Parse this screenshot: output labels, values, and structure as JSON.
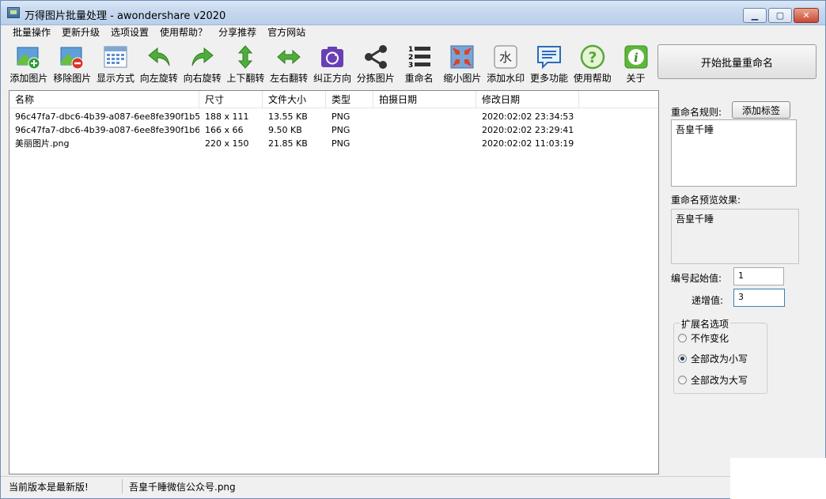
{
  "window": {
    "title": "万得图片批量处理 - awondershare v2020"
  },
  "menu": [
    "批量操作",
    "更新升级",
    "选项设置",
    "使用帮助？",
    "分享推荐",
    "官方网站"
  ],
  "toolbar": [
    {
      "label": "添加图片",
      "icon": "add-image-icon"
    },
    {
      "label": "移除图片",
      "icon": "remove-image-icon"
    },
    {
      "label": "显示方式",
      "icon": "display-mode-icon"
    },
    {
      "label": "向左旋转",
      "icon": "rotate-left-icon"
    },
    {
      "label": "向右旋转",
      "icon": "rotate-right-icon"
    },
    {
      "label": "上下翻转",
      "icon": "flip-vertical-icon"
    },
    {
      "label": "左右翻转",
      "icon": "flip-horizontal-icon"
    },
    {
      "label": "纠正方向",
      "icon": "correct-orientation-icon"
    },
    {
      "label": "分拣图片",
      "icon": "sort-images-icon"
    },
    {
      "label": "重命名",
      "icon": "rename-icon"
    },
    {
      "label": "缩小图片",
      "icon": "shrink-image-icon"
    },
    {
      "label": "添加水印",
      "icon": "watermark-icon"
    },
    {
      "label": "更多功能",
      "icon": "more-features-icon"
    },
    {
      "label": "使用帮助",
      "icon": "help-icon"
    },
    {
      "label": "关于",
      "icon": "info-icon"
    }
  ],
  "start_button": "开始批量重命名",
  "filelist": {
    "columns": [
      "名称",
      "尺寸",
      "文件大小",
      "类型",
      "拍摄日期",
      "修改日期"
    ],
    "rows": [
      [
        "96c47fa7-dbc6-4b39-a087-6ee8fe390f1b5.png",
        "188 x 111",
        "13.55 KB",
        "PNG",
        "",
        "2020:02:02 23:34:53"
      ],
      [
        "96c47fa7-dbc6-4b39-a087-6ee8fe390f1b6.png",
        "166 x 66",
        "9.50 KB",
        "PNG",
        "",
        "2020:02:02 23:29:41"
      ],
      [
        "美丽图片.png",
        "220 x 150",
        "21.85 KB",
        "PNG",
        "",
        "2020:02:02 11:03:19"
      ]
    ]
  },
  "right_panel": {
    "rule_label": "重命名规则:",
    "add_tag_button": "添加标签",
    "rule_value": "吾皇千睡",
    "preview_label": "重命名预览效果:",
    "preview_value": "吾皇千睡",
    "start_num_label": "编号起始值:",
    "start_num_value": "1",
    "increment_label": "递增值:",
    "increment_value": "3",
    "ext_group_label": "扩展名选项",
    "ext_options": [
      {
        "label": "不作变化",
        "checked": false
      },
      {
        "label": "全部改为小写",
        "checked": true
      },
      {
        "label": "全部改为大写",
        "checked": false
      }
    ]
  },
  "status": {
    "version": "当前版本是最新版!",
    "file": "吾皇千睡微信公众号.png"
  },
  "colors": {
    "accent": "#3c7fb1",
    "titlebar": "#c7d8ee"
  }
}
